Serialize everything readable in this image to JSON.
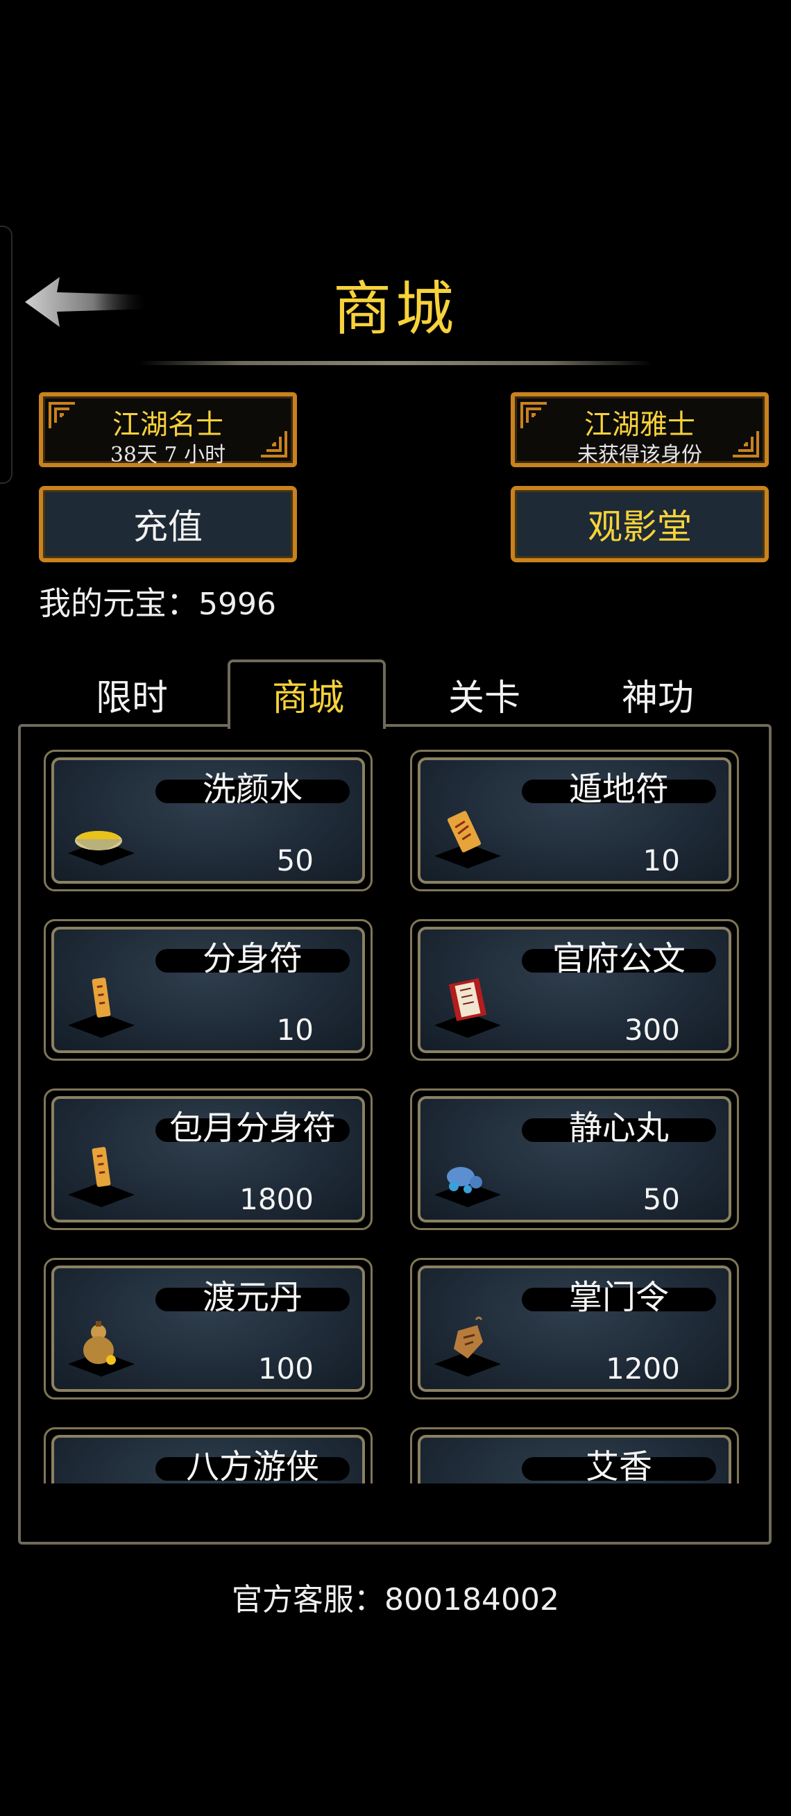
{
  "header": {
    "title": "商城"
  },
  "identity_cards": [
    {
      "name": "江湖名士",
      "status": "38天 7 小时"
    },
    {
      "name": "江湖雅士",
      "status": "未获得该身份"
    }
  ],
  "buttons": {
    "recharge": "充值",
    "theater": "观影堂"
  },
  "balance": {
    "label": "我的元宝：",
    "value": "5996"
  },
  "tabs": [
    "限时",
    "商城",
    "关卡",
    "神功"
  ],
  "active_tab": "商城",
  "items": [
    {
      "name": "洗颜水",
      "price": "50",
      "icon": "bowl-icon"
    },
    {
      "name": "遁地符",
      "price": "10",
      "icon": "talisman-icon"
    },
    {
      "name": "分身符",
      "price": "10",
      "icon": "clone-talisman-icon"
    },
    {
      "name": "官府公文",
      "price": "300",
      "icon": "document-scroll-icon"
    },
    {
      "name": "包月分身符",
      "price": "1800",
      "icon": "clone-talisman-icon"
    },
    {
      "name": "静心丸",
      "price": "50",
      "icon": "blue-pill-icon"
    },
    {
      "name": "渡元丹",
      "price": "100",
      "icon": "gourd-icon"
    },
    {
      "name": "掌门令",
      "price": "1200",
      "icon": "token-icon"
    },
    {
      "name": "八方游侠",
      "price": "",
      "icon": "red-charm-icon"
    },
    {
      "name": "艾香",
      "price": "",
      "icon": "incense-icon"
    }
  ],
  "footer": {
    "service_label": "官方客服：",
    "service_number": "800184002"
  },
  "colors": {
    "accent_gold": "#f7d23b",
    "border_orange": "#c8821e",
    "panel_border": "#6f6a5b"
  }
}
